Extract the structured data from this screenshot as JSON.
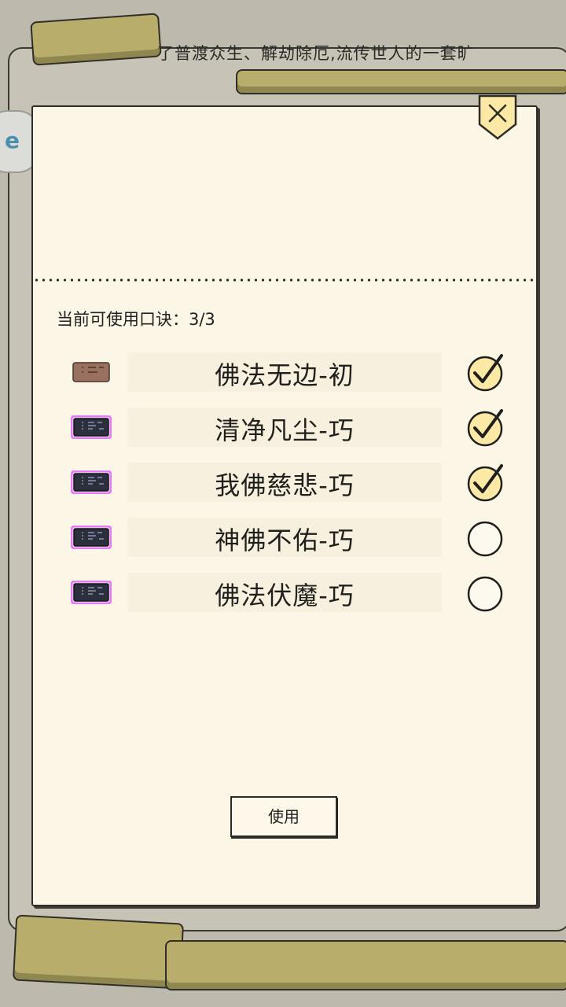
{
  "background": {
    "description_line1": "了普渡众生、解劫除厄,流传世人的一套旷",
    "description_line2": "流传世人的一套旷"
  },
  "counter": {
    "label": "当前可使用口诀：",
    "value": "3/3"
  },
  "spells": [
    {
      "name": "佛法无边-初",
      "checked": true,
      "book_color": "brown"
    },
    {
      "name": "清净凡尘-巧",
      "checked": true,
      "book_color": "purple"
    },
    {
      "name": "我佛慈悲-巧",
      "checked": true,
      "book_color": "purple"
    },
    {
      "name": "神佛不佑-巧",
      "checked": false,
      "book_color": "purple"
    },
    {
      "name": "佛法伏魔-巧",
      "checked": false,
      "book_color": "purple"
    }
  ],
  "use_button": {
    "label": "使用"
  },
  "colors": {
    "panel_bg": "#fcf6e7",
    "check_fill": "#fde9a6",
    "glow_purple": "#e05cff",
    "brown_book": "#9a7060"
  }
}
